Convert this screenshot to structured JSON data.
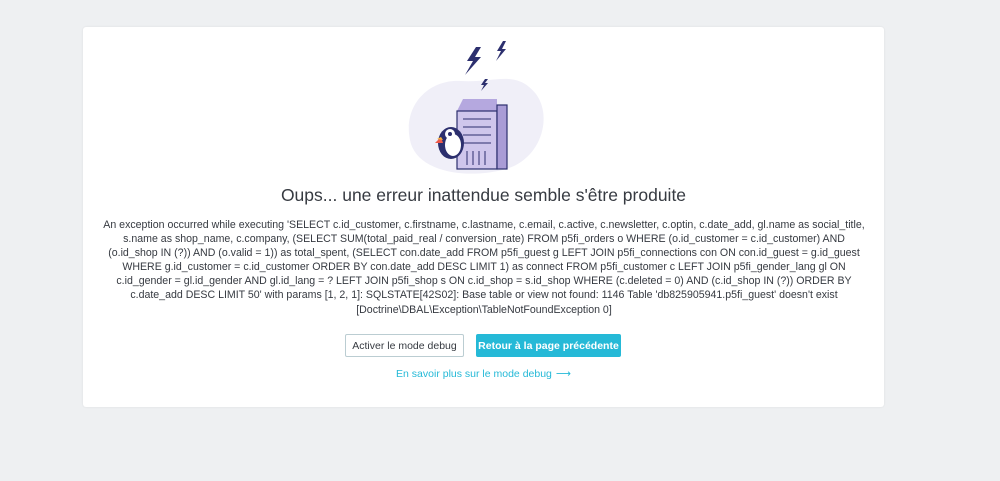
{
  "error": {
    "title": "Oups... une erreur inattendue semble s'être produite",
    "message": "An exception occurred while executing 'SELECT c.id_customer, c.firstname, c.lastname, c.email, c.active, c.newsletter, c.optin, c.date_add, gl.name as social_title, s.name as shop_name, c.company, (SELECT SUM(total_paid_real / conversion_rate) FROM p5fi_orders o WHERE (o.id_customer = c.id_customer) AND (o.id_shop IN (?)) AND (o.valid = 1)) as total_spent, (SELECT con.date_add FROM p5fi_guest g LEFT JOIN p5fi_connections con ON con.id_guest = g.id_guest WHERE g.id_customer = c.id_customer ORDER BY con.date_add DESC LIMIT 1) as connect FROM p5fi_customer c LEFT JOIN p5fi_gender_lang gl ON c.id_gender = gl.id_gender AND gl.id_lang = ? LEFT JOIN p5fi_shop s ON c.id_shop = s.id_shop WHERE (c.deleted = 0) AND (c.id_shop IN (?)) ORDER BY c.date_add DESC LIMIT 50' with params [1, 2, 1]: SQLSTATE[42S02]: Base table or view not found: 1146 Table 'db825905941.p5fi_guest' doesn't exist",
    "exception": "[Doctrine\\DBAL\\Exception\\TableNotFoundException 0]"
  },
  "actions": {
    "debug_label": "Activer le mode debug",
    "back_label": "Retour à la page précédente",
    "learn_more_label": "En savoir plus sur le mode debug",
    "learn_more_arrow": "⟶"
  },
  "colors": {
    "accent": "#25b9d7",
    "text": "#363a41",
    "background": "#eef0f2",
    "illustration_blob": "#f0eff8",
    "server": "#c8bde8"
  },
  "icons": {
    "illustration": "server-error-puffin-illustration",
    "arrow": "arrow-right-icon"
  }
}
